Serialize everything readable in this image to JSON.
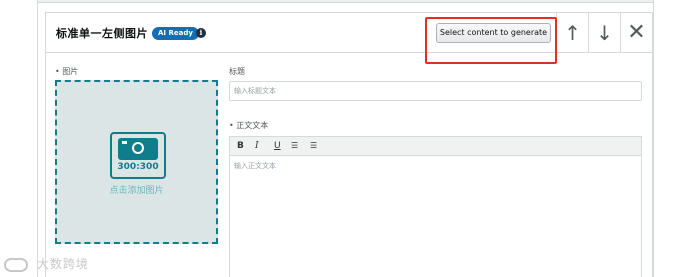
{
  "module": {
    "title": "标准单一左侧图片",
    "ai_badge": "AI Ready",
    "info_icon": "i",
    "generate_button": "Select content to generate",
    "controls": {
      "move_up": "↑",
      "move_down": "↓",
      "remove": "✕"
    }
  },
  "image_field": {
    "required_mark": "•",
    "label": "图片",
    "dimensions": "300:300",
    "add_text": "点击添加图片"
  },
  "headline_field": {
    "label": "标题",
    "placeholder": "输入标题文本"
  },
  "body_field": {
    "required_mark": "•",
    "label": "正文文本",
    "placeholder": "输入正文文本",
    "toolbar": {
      "bold": "B",
      "italic": "I",
      "underline": "U",
      "bullet_list": "☰",
      "numbered_list": "☰"
    }
  },
  "watermark": {
    "text": "大数跨境"
  },
  "colors": {
    "accent_teal": "#0f7d8c",
    "badge_blue": "#146eb4",
    "highlight_red": "#e0301e"
  }
}
